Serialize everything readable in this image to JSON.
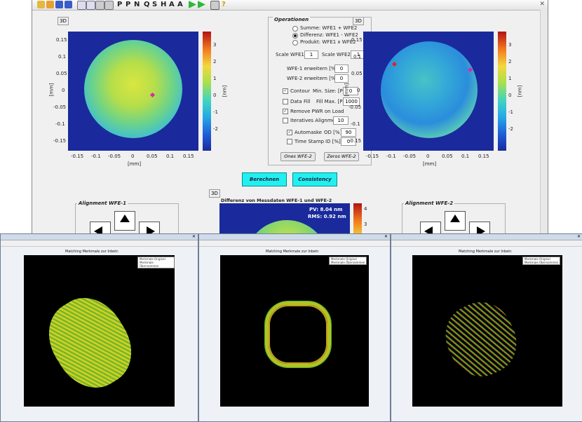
{
  "main_window": {
    "toolbar_text_icons": [
      "P",
      "P",
      "N",
      "Q",
      "S",
      "H",
      "A",
      "A"
    ],
    "three_d_label": "3D",
    "left_plot": {
      "y_ticks": [
        "0.15",
        "0.1",
        "0.05",
        "0",
        "-0.05",
        "-0.1",
        "-0.15"
      ],
      "x_ticks": [
        "-0.15",
        "-0.1",
        "-0.05",
        "0",
        "0.05",
        "0.1",
        "0.15"
      ],
      "x_unit": "[mm]",
      "y_unit": "[mm]",
      "cbar_ticks": [
        "3",
        "2",
        "1",
        "0",
        "-1",
        "-2"
      ],
      "cbar_unit": "[nm]"
    },
    "right_plot": {
      "y_ticks": [
        "0.15",
        "0.1",
        "0.05",
        "0",
        "-0.05",
        "-0.1",
        "-0.15"
      ],
      "x_ticks": [
        "-0.15",
        "-0.1",
        "-0.05",
        "0",
        "0.05",
        "0.1",
        "0.15"
      ],
      "x_unit": "[mm]",
      "y_unit": "[mm]",
      "cbar_ticks": [
        "3",
        "2",
        "1",
        "0",
        "-1",
        "-2"
      ],
      "cbar_unit": "[nm]"
    },
    "operations": {
      "title": "Operationen",
      "radio_summe": "Summe:  WFE1 + WFE2",
      "radio_differenz": "Differenz: WFE1 - WFE2",
      "radio_produkt": "Produkt: WFE1 x WFE2",
      "scale_wfe1_label": "Scale WFE1:",
      "scale_wfe1_value": "1",
      "scale_wfe2_label": "Scale WFE2:",
      "scale_wfe2_value": "1",
      "wfe1_erweitern_label": "WFE-1 erweitern [%]:",
      "wfe1_erweitern_value": "0",
      "wfe2_erweitern_label": "WFE-2 erweitern [%]:",
      "wfe2_erweitern_value": "0",
      "contour_label": "Contour",
      "min_size_label": "Min. Size: [Px]:",
      "min_size_value": "0",
      "data_fill_label": "Data Fill",
      "fill_max_label": "Fill Max. [Px]:",
      "fill_max_value": "1000",
      "remove_pwr_label": "Remove PWR on Load",
      "iteratives_label": "Iteratives Alignment",
      "iteratives_value": "10",
      "automaske_label": "Automaske",
      "od_label": "OD [%]:",
      "od_value": "90",
      "time_stamp_label": "Time Stamp",
      "id_label": "ID [%]:",
      "id_value": "0",
      "ones_label": "Ones WFE-2",
      "zeros_label": "Zeros WFE-2"
    },
    "berechnen_label": "Berechnen",
    "consistency_label": "Consistency",
    "alignment_wfe1_title": "Alignment WFE-1",
    "alignment_wfe2_title": "Alignment WFE-2",
    "diff_title": "Differenz von Messdaten WFE-1 und WFE-2",
    "diff_pv": "PV: 8.04 nm",
    "diff_rms": "RMS: 0.92 nm",
    "diff_cbar_ticks": [
      "4",
      "3"
    ]
  },
  "popups": [
    {
      "title": "Matching Merkmale zur Inbetr.",
      "legend_1": "Merkmale Original",
      "legend_2": "Merkmale Übernommen"
    },
    {
      "title": "Matching Merkmale zur Inbetr.",
      "legend_1": "Merkmale Original",
      "legend_2": "Merkmale Übernommen"
    },
    {
      "title": "Matching Merkmale zur Inbetr.",
      "legend_1": "Merkmale Original",
      "legend_2": "Merkmale Übernommen"
    }
  ],
  "colors": {
    "cyan_button": "#22f0f0",
    "plot_background": "#1a2a9c",
    "feature_green": "#4ec82c",
    "feature_yellow": "#e8e82a",
    "feature_red": "#d83a1e"
  }
}
